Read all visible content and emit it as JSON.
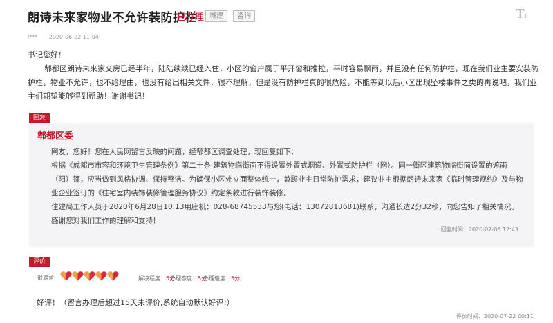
{
  "header": {
    "title": "朗诗未来家物业不允许装防护栏",
    "status": "已办理",
    "tags": [
      "城建",
      "咨询"
    ],
    "font_icon": "T"
  },
  "meta": {
    "user": "l***",
    "date": "2020-06-22 11:04"
  },
  "letter": {
    "greeting": "书记您好！",
    "body": "郫都区朗诗未来家交房已经半年，陆陆续续已经入住，小区的窗户属于平开窗和推拉，平时容易飘雨，并且没有任何防护栏，现在我们业主要安装防护栏，物业不允许，也不给理由，也没有给出相关文件，很不理解，但是没有防护栏真的很危险，不能等到以后小区出现坠楼事件之类的再说吧，我们业主们期望能够得到帮助！谢谢书记！"
  },
  "reply": {
    "label": "回复",
    "department": "郫都区委",
    "paragraphs": [
      "网友，您好！您在人民网留言反映的问题，经郫都区调查处理，现回复如下：",
      "根据《成都市市容和环境卫生管理条例》第二十条 建筑物临街面不得设置外置式烟道、外置式防护栏（网）。同一街区建筑物临街面设置的遮雨（阳）篷，应当做到风格协调、保持整洁。为确保小区外立面整体统一，兼顾业主日常防护需求，建议业主根据朗诗未来家《临时管理规约》及与物业企业签订的《住宅室内装饰装修管理服务协议》约定条款进行装饰装修。",
      "住建局工作人员于2020年6月28日10:13用座机：028-68745533与您(电话：13072813681)联系，沟通长达2分32秒，向您告知了相关情况。",
      "感谢您对我们工作的理解和支持！"
    ],
    "time": "回复时间：2020-07-06 12:43"
  },
  "evaluation": {
    "label": "评价",
    "satisfaction_label": "很满意",
    "hearts_filled": 5,
    "hearts_total": 5,
    "scores": [
      {
        "label": "解决程度：",
        "value": "5分"
      },
      {
        "label": "办理态度：",
        "value": "5分"
      },
      {
        "label": "办理速度：",
        "value": "5分"
      }
    ],
    "comment": "好评！（留言办理后超过15天未评价,系统自动默认好评!）",
    "time": "评价时间：2020-07-22 00:11"
  },
  "colors": {
    "accent": "#c8192a",
    "heart_orange": "#f0a040",
    "heart_red": "#d8263a",
    "reply_bg": "#f4f4f6"
  }
}
